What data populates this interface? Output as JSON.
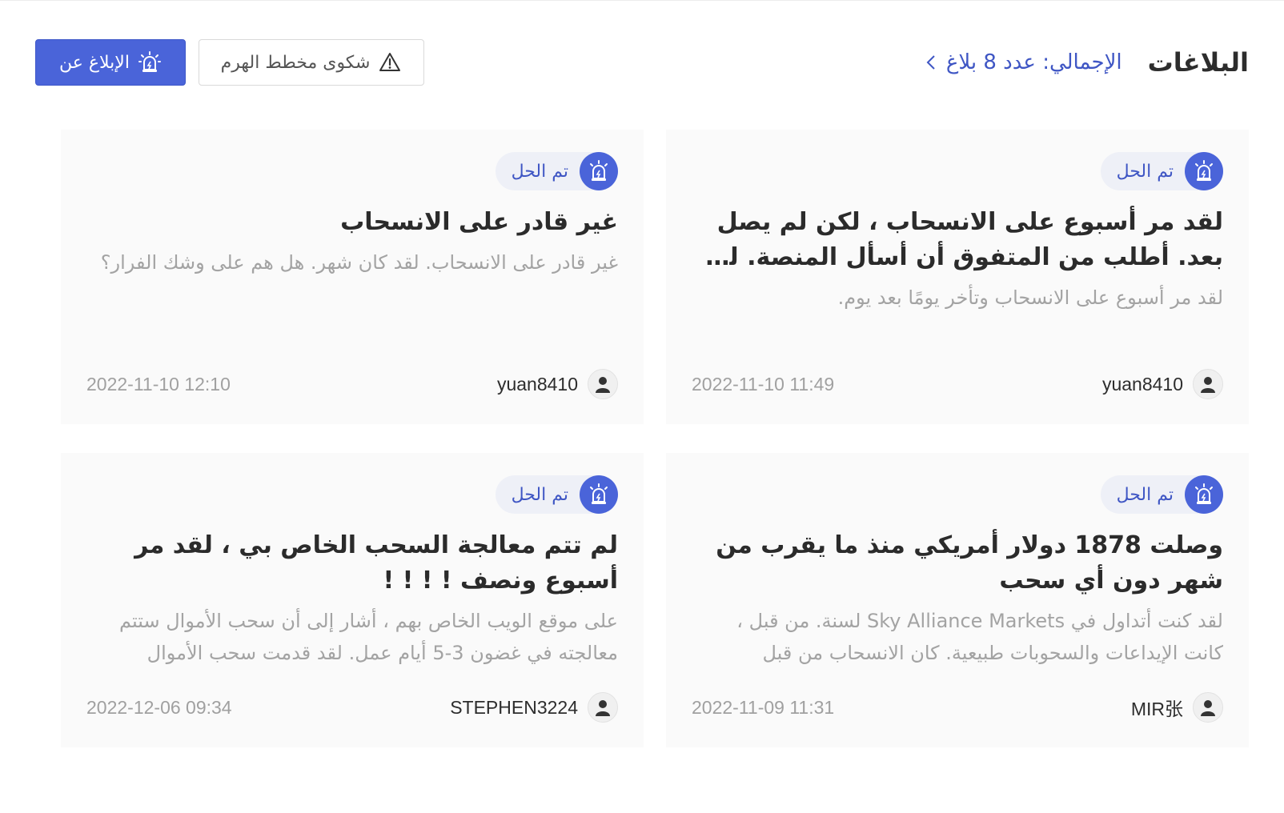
{
  "header": {
    "title": "البلاغات",
    "total_label": "الإجمالي: عدد 8 بلاغ",
    "pyramid_button": "شكوى مخطط الهرم",
    "report_button": "الإبلاغ عن"
  },
  "colors": {
    "accent": "#4a64d9",
    "link": "#3f56c4",
    "card_bg": "#fafafa",
    "muted_text": "#a3a3a3"
  },
  "complaints": [
    {
      "status": "تم الحل",
      "title": "لقد مر أسبوع على الانسحاب ، لكن لم يصل بعد. أطلب من المتفوق أن أسأل المنصة. لقد مر أسبوع على الانسحاب",
      "body": "لقد مر أسبوع على الانسحاب وتأخر يومًا بعد يوم.",
      "username": "yuan8410",
      "date": "2022-11-10 11:49"
    },
    {
      "status": "تم الحل",
      "title": "غير قادر على الانسحاب",
      "body": "غير قادر على الانسحاب. لقد كان شهر. هل هم على وشك الفرار؟",
      "username": "yuan8410",
      "date": "2022-11-10 12:10"
    },
    {
      "status": "تم الحل",
      "title": "وصلت 1878 دولار أمريكي منذ ما يقرب من شهر دون أي سحب",
      "body": "لقد كنت أتداول في Sky Alliance Markets لسنة. من قبل ، كانت الإيداعات والسحوبات طبيعية. كان الانسحاب من قبل",
      "username": "MIR张",
      "date": "2022-11-09 11:31"
    },
    {
      "status": "تم الحل",
      "title": "لم تتم معالجة السحب الخاص بي ، لقد مر أسبوع ونصف ! ! ! !",
      "body": "على موقع الويب الخاص بهم ، أشار إلى أن سحب الأموال ستتم معالجته في غضون 3-5 أيام عمل. لقد قدمت سحب الأموال",
      "username": "STEPHEN3224",
      "date": "2022-12-06 09:34"
    }
  ]
}
